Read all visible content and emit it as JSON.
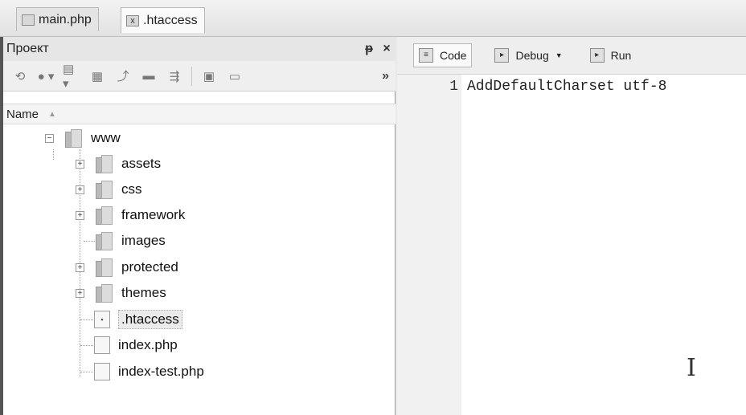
{
  "tabs": [
    {
      "label": "main.php",
      "icon": "php-file-icon",
      "active": false
    },
    {
      "label": ".htaccess",
      "icon": "close-icon",
      "icon_glyph": "x",
      "active": true
    }
  ],
  "project_panel": {
    "title": "Проект",
    "pin_glyph": "ᵽ",
    "close_glyph": "×",
    "toolbar": {
      "items": [
        "sync-icon",
        "circle-dropdown-icon",
        "folder-dropdown-icon",
        "copy-icon",
        "link-icon",
        "minus-icon",
        "split-icon",
        "properties-icon",
        "window-icon"
      ],
      "overflow_glyph": "»"
    },
    "column_header": "Name",
    "tree": {
      "root": {
        "label": "www",
        "expanded": true
      },
      "children": [
        {
          "label": "assets",
          "type": "folder",
          "expandable": true
        },
        {
          "label": "css",
          "type": "folder",
          "expandable": true
        },
        {
          "label": "framework",
          "type": "folder",
          "expandable": true
        },
        {
          "label": "images",
          "type": "folder",
          "expandable": false
        },
        {
          "label": "protected",
          "type": "folder",
          "expandable": true
        },
        {
          "label": "themes",
          "type": "folder",
          "expandable": true
        },
        {
          "label": ".htaccess",
          "type": "file",
          "selected": true
        },
        {
          "label": "index.php",
          "type": "file",
          "selected": false
        },
        {
          "label": "index-test.php",
          "type": "file",
          "selected": false
        }
      ]
    }
  },
  "editor": {
    "toolbar": {
      "code_label": "Code",
      "debug_label": "Debug",
      "run_label": "Run"
    },
    "lines": [
      {
        "number": "1",
        "text": "AddDefaultCharset utf-8"
      }
    ]
  }
}
